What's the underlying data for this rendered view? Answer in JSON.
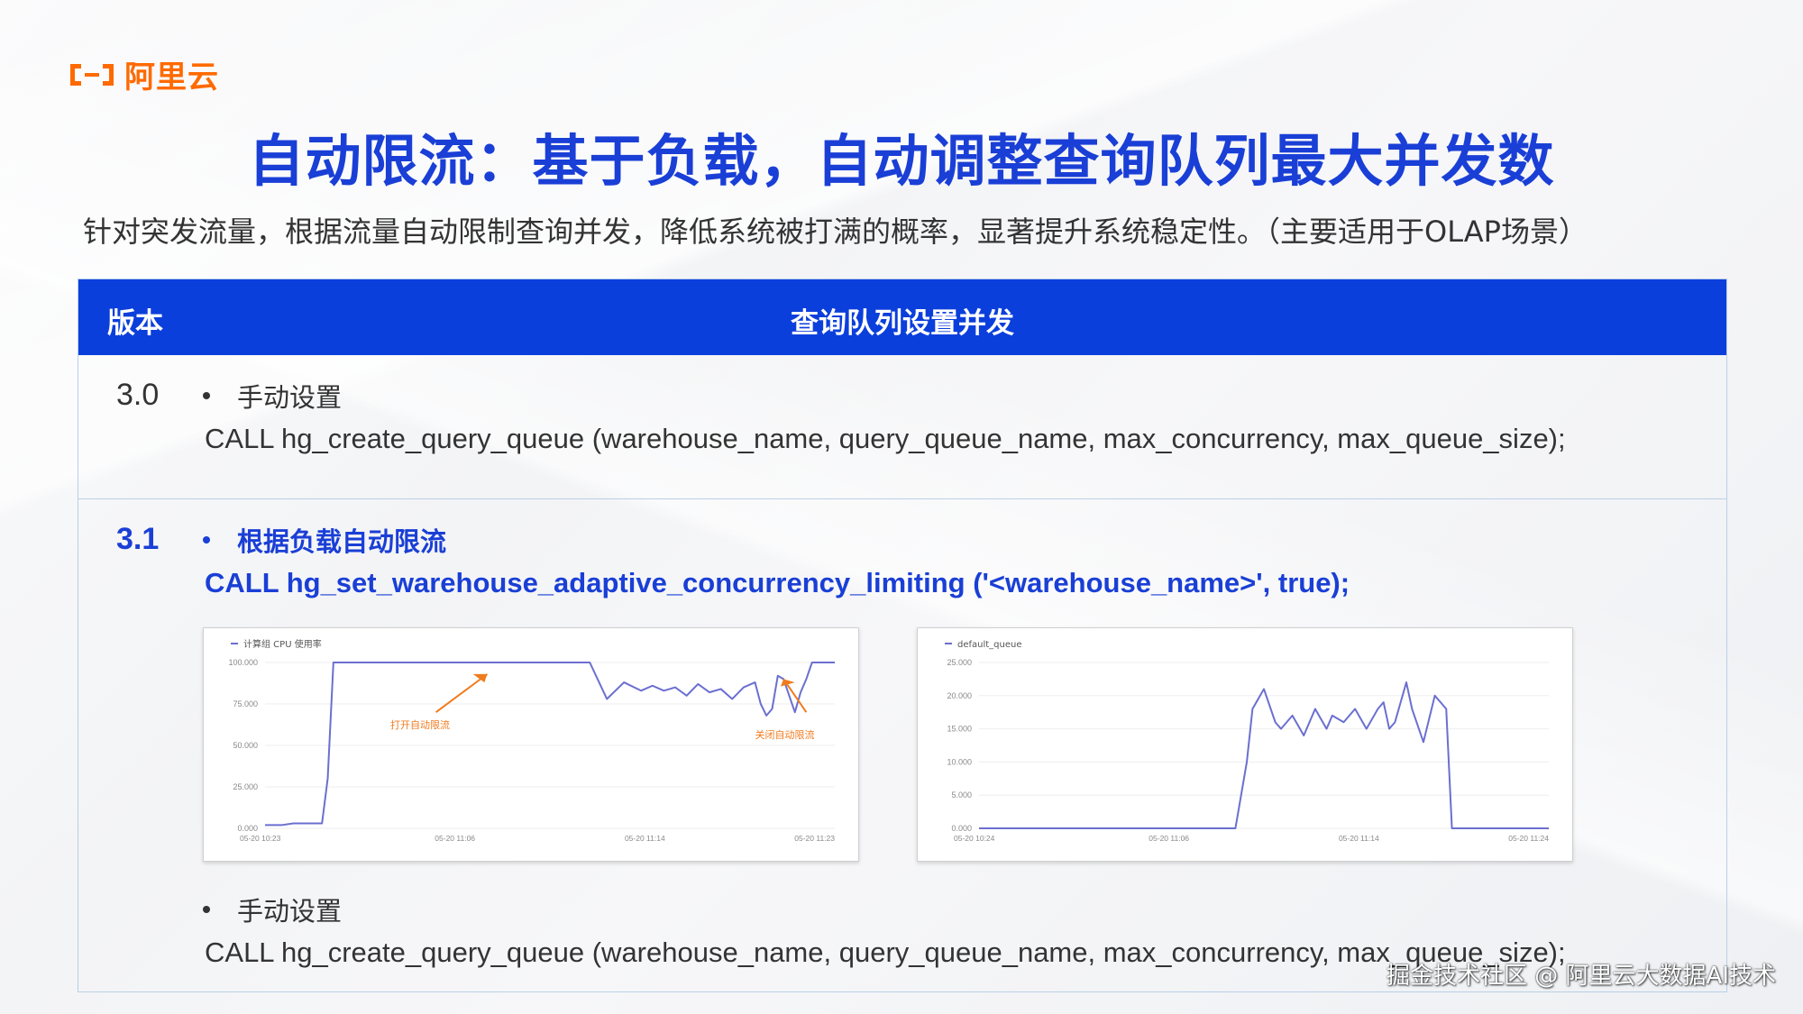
{
  "logo": {
    "text": "阿里云",
    "icon": "aliyun-logo-icon",
    "color": "#ff6a00"
  },
  "title": "自动限流：基于负载，自动调整查询队列最大并发数",
  "subtitle": "针对突发流量，根据流量自动限制查询并发，降低系统被打满的概率，显著提升系统稳定性。（主要适用于OLAP场景）",
  "colors": {
    "title": "#1a3fd6",
    "header_bg": "#0b3fdc",
    "accent_line": "#6b6fd0",
    "annotation": "#f07b1e"
  },
  "table": {
    "headers": {
      "version": "版本",
      "setting": "查询队列设置并发"
    },
    "rows": [
      {
        "version": "3.0",
        "bullet": "手动设置",
        "code": "CALL hg_create_query_queue (warehouse_name, query_queue_name, max_concurrency, max_queue_size);"
      },
      {
        "version": "3.1",
        "bullet": "根据负载自动限流",
        "code": "CALL hg_set_warehouse_adaptive_concurrency_limiting ('<warehouse_name>', true);",
        "bullet2": "手动设置",
        "code2": "CALL hg_create_query_queue (warehouse_name, query_queue_name, max_concurrency, max_queue_size);"
      }
    ]
  },
  "chart_data": [
    {
      "type": "line",
      "legend": "计算组 CPU 使用率",
      "ylim": [
        0,
        100
      ],
      "yticks": [
        "100.000",
        "75.000",
        "50.000",
        "25.000",
        "0.000"
      ],
      "xticks": [
        "05-20 10:23",
        "05-20 11:06",
        "05-20 11:14",
        "05-20 11:23"
      ],
      "annotations": [
        "打开自动限流",
        "关闭自动限流"
      ],
      "series": [
        {
          "name": "计算组 CPU 使用率",
          "x": [
            0,
            3,
            5,
            8,
            10,
            11,
            12,
            20,
            30,
            40,
            50,
            57,
            60,
            63,
            66,
            68,
            70,
            72,
            74,
            76,
            78,
            80,
            82,
            84,
            86,
            87,
            88,
            89,
            90,
            91,
            92,
            93,
            94,
            95,
            96,
            98,
            100
          ],
          "y": [
            2,
            2,
            3,
            3,
            3,
            30,
            100,
            100,
            100,
            100,
            100,
            100,
            78,
            88,
            83,
            86,
            83,
            85,
            80,
            87,
            82,
            84,
            78,
            85,
            88,
            75,
            68,
            72,
            92,
            90,
            80,
            70,
            82,
            90,
            100,
            100,
            100
          ]
        }
      ]
    },
    {
      "type": "line",
      "legend": "default_queue",
      "ylim": [
        0,
        25
      ],
      "yticks": [
        "25.000",
        "20.000",
        "15.000",
        "10.000",
        "5.000",
        "0.000"
      ],
      "xticks": [
        "05-20 10:24",
        "05-20 11:06",
        "05-20 11:14",
        "05-20 11:24"
      ],
      "series": [
        {
          "name": "default_queue",
          "x": [
            0,
            10,
            20,
            30,
            40,
            45,
            47,
            48,
            50,
            52,
            53,
            55,
            57,
            59,
            61,
            62,
            64,
            66,
            68,
            70,
            71,
            72,
            73,
            75,
            76,
            78,
            80,
            81,
            82,
            83,
            85,
            86,
            90,
            95,
            100
          ],
          "y": [
            0,
            0,
            0,
            0,
            0,
            0,
            10,
            18,
            21,
            16,
            15,
            17,
            14,
            18,
            15,
            17,
            16,
            18,
            15,
            18,
            19,
            15,
            16,
            22,
            18,
            13,
            20,
            19,
            18,
            0,
            0,
            0,
            0,
            0,
            0
          ]
        }
      ]
    }
  ],
  "watermark": "掘金技术社区 @ 阿里云大数据AI技术"
}
